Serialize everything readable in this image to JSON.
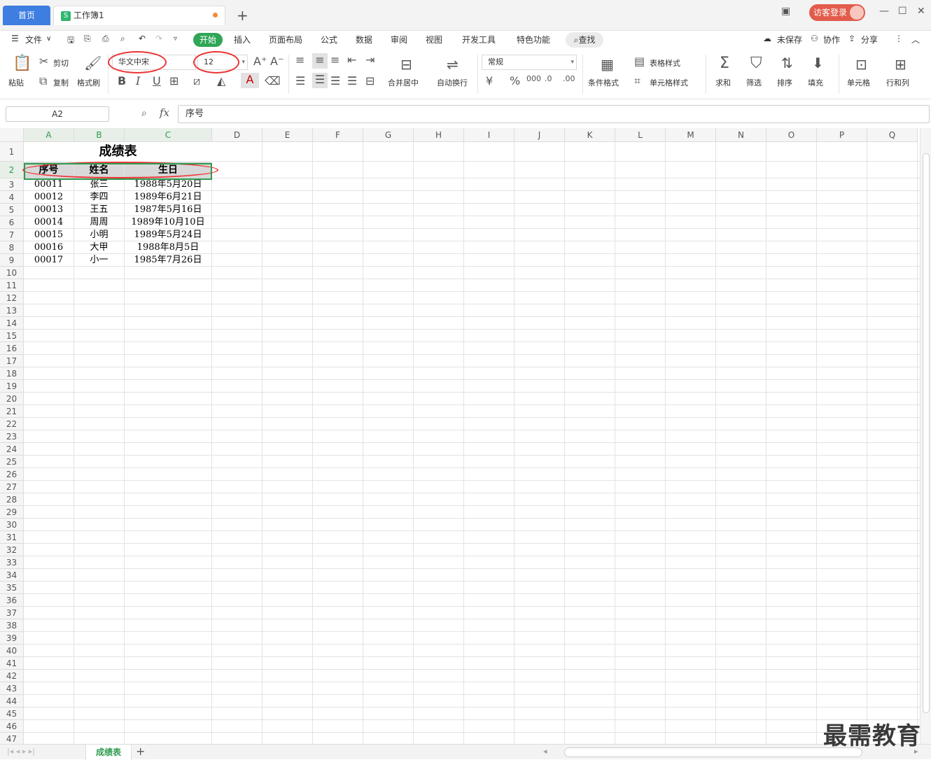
{
  "titlebar": {
    "home_tab": "首页",
    "doc_tab": "工作簿1",
    "login_label": "访客登录"
  },
  "menu": {
    "file": "文件",
    "tabs": [
      "开始",
      "插入",
      "页面布局",
      "公式",
      "数据",
      "审阅",
      "视图",
      "开发工具",
      "特色功能"
    ],
    "search": "查找",
    "unsaved": "未保存",
    "collab": "协作",
    "share": "分享"
  },
  "ribbon": {
    "paste": "粘贴",
    "cut": "剪切",
    "copy": "复制",
    "format_painter": "格式刷",
    "font_name": "华文中宋",
    "font_size": "12",
    "number_format": "常规",
    "merge_center": "合并居中",
    "wrap_text": "自动换行",
    "table_style": "表格样式",
    "cond_format": "条件格式",
    "cell_style": "单元格样式",
    "sum": "求和",
    "filter": "筛选",
    "sort": "排序",
    "fill": "填充",
    "cells": "单元格",
    "rows_cols": "行和列"
  },
  "formula": {
    "name_box": "A2",
    "fx": "fx",
    "content": "序号"
  },
  "grid": {
    "columns": [
      "A",
      "B",
      "C",
      "D",
      "E",
      "F",
      "G",
      "H",
      "I",
      "J",
      "K",
      "L",
      "M",
      "N",
      "O",
      "P",
      "Q"
    ],
    "title": "成绩表",
    "headers": [
      "序号",
      "姓名",
      "生日"
    ],
    "rows": [
      [
        "00011",
        "张三",
        "1988年5月20日"
      ],
      [
        "00012",
        "李四",
        "1989年6月21日"
      ],
      [
        "00013",
        "王五",
        "1987年5月16日"
      ],
      [
        "00014",
        "周周",
        "1989年10月10日"
      ],
      [
        "00015",
        "小明",
        "1989年5月24日"
      ],
      [
        "00016",
        "大甲",
        "1988年8月5日"
      ],
      [
        "00017",
        "小一",
        "1985年7月26日"
      ]
    ],
    "row_count": 47
  },
  "sheets": {
    "active": "成绩表"
  },
  "watermark": "最需教育",
  "colors": {
    "accent_green": "#2fa657",
    "home_blue": "#3d7ee0",
    "annotation_red": "#e33333"
  }
}
